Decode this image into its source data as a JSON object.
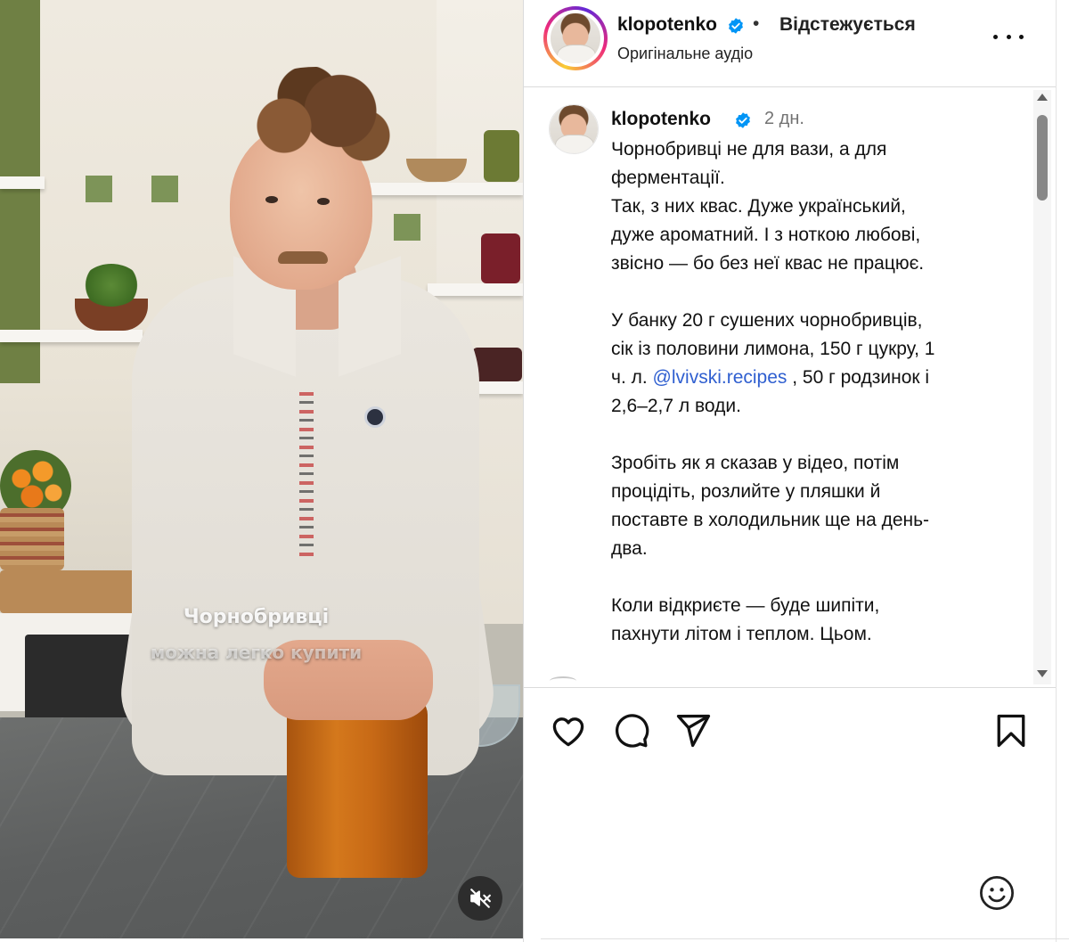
{
  "video": {
    "overlay_line1": "Чорнобривці",
    "overlay_line2": "можна легко купити",
    "mute_icon": "speaker-muted-icon"
  },
  "header": {
    "username": "klopotenko",
    "separator": "•",
    "follow_status": "Відстежується",
    "audio_label": "Оригінальне аудіо",
    "more_icon": "more-options-icon"
  },
  "caption": {
    "username": "klopotenko",
    "time_ago": "2 дн.",
    "p1_line1": "Чорнобривці не для вази, а для",
    "p1_line2": "ферментації.",
    "p2_line1": "Так, з них квас. Дуже український,",
    "p2_line2": "дуже ароматний. І з ноткою любові,",
    "p2_line3": "звісно — бо без неї квас не працює.",
    "p3_line1": "У банку 20 г сушених чорнобривців,",
    "p3_line2": "сік із половини лимона, 150 г цукру, 1",
    "p3_line3_prefix": "ч. л.",
    "p3_mention": "@lvivski.recipes",
    "p3_line3_suffix": ", 50 г родзинок і",
    "p3_line4": "2,6–2,7 л води.",
    "p4_line1": "Зробіть як я сказав у відео, потім",
    "p4_line2": "процідіть, розлийте у пляшки й",
    "p4_line3": "поставте в холодильник ще на день-",
    "p4_line4": "два.",
    "p5_line1": "Коли відкриєте — буде шипіти,",
    "p5_line2": "пахнути літом і теплом. Цьом."
  },
  "actions": {
    "like_icon": "heart-icon",
    "comment_icon": "comment-icon",
    "share_icon": "share-icon",
    "save_icon": "bookmark-icon",
    "emoji_icon": "emoji-icon"
  },
  "colors": {
    "mention": "#2f5fd0",
    "verified": "#0095f6",
    "muted_text": "#737373"
  }
}
